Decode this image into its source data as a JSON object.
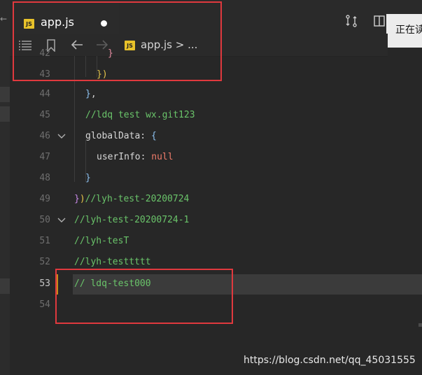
{
  "tab": {
    "title": "app.js",
    "icon": "js-file-icon",
    "badge": "JS",
    "dirty": true
  },
  "tooltip": {
    "text": "正在读"
  },
  "breadcrumb": {
    "file": "app.js",
    "separator": ">",
    "ellipsis": "..."
  },
  "colors": {
    "accent_modified": "#c78a19",
    "annotation_box": "#e0393e",
    "js_badge": "#e8c22a"
  },
  "code": {
    "line_numbers": [
      "42",
      "43",
      "44",
      "45",
      "46",
      "47",
      "48",
      "49",
      "50",
      "51",
      "52",
      "53",
      "54"
    ],
    "l42": "}",
    "l43": "})",
    "l44_brace": "}",
    "l44_comma": ",",
    "l45": "//ldq test wx.git123",
    "l46_key": "globalData",
    "l46_colon": ": ",
    "l46_brace": "{",
    "l47_key": "userInfo",
    "l47_colon": ": ",
    "l47_val": "null",
    "l48": "}",
    "l49_brace1": "}",
    "l49_paren": ")",
    "l49_comment": "//lyh-test-20200724",
    "l50": "//lyh-test-20200724-1",
    "l51": "//lyh-tesT",
    "l52": "//lyh-testtttt",
    "l53": "// ldq-test000"
  },
  "watermark": "https://blog.csdn.net/qq_45031555"
}
